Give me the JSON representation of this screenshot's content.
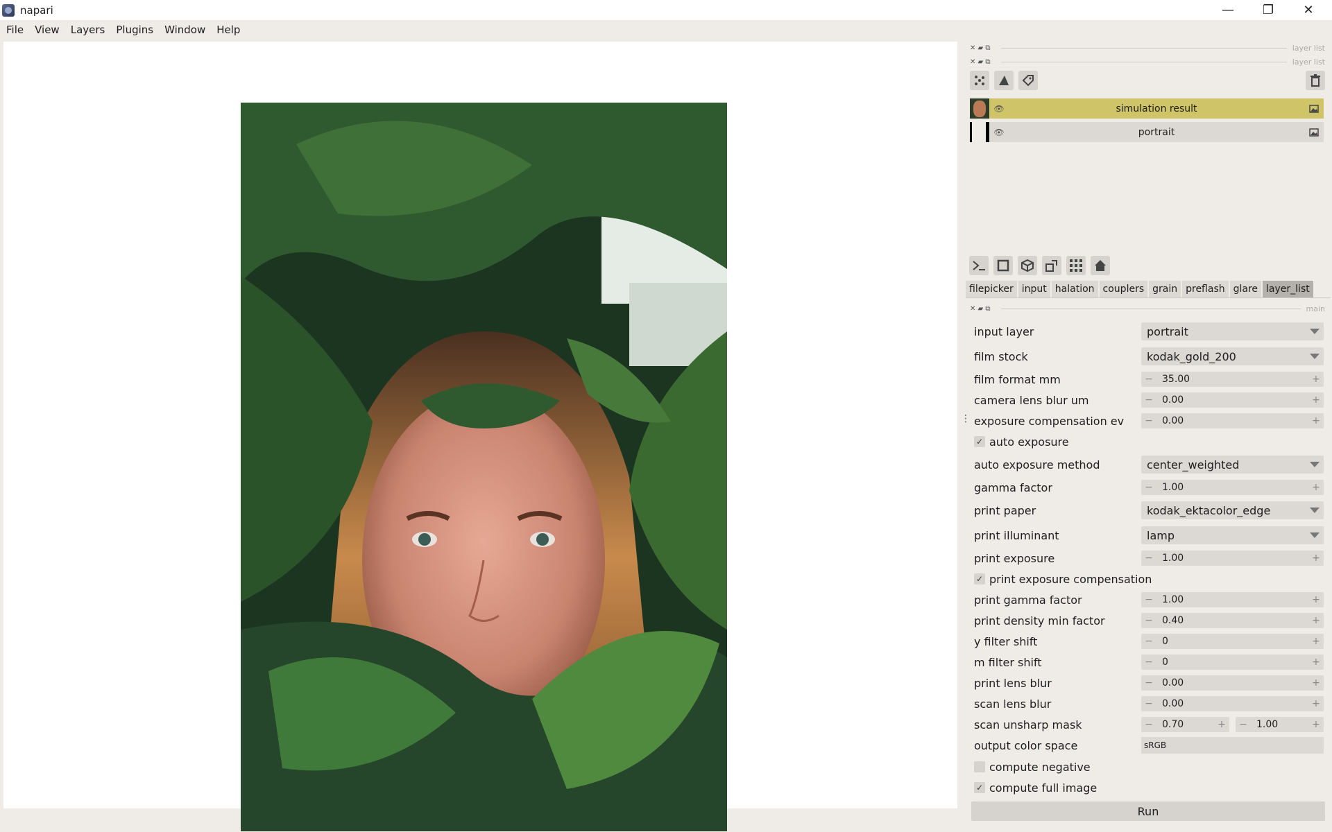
{
  "window": {
    "title": "napari",
    "minimize_icon": "—",
    "maximize_icon": "❐",
    "close_icon": "✕"
  },
  "menubar": [
    "File",
    "View",
    "Layers",
    "Plugins",
    "Window",
    "Help"
  ],
  "docks": {
    "layer_list_title_1": "layer list",
    "layer_list_title_2": "layer list",
    "main_title": "main"
  },
  "layers": [
    {
      "name": "simulation result",
      "selected": true,
      "type_icon": "image-icon"
    },
    {
      "name": "portrait",
      "selected": false,
      "type_icon": "image-icon"
    }
  ],
  "tabs": [
    "filepicker",
    "input",
    "halation",
    "couplers",
    "grain",
    "preflash",
    "glare",
    "layer_list"
  ],
  "active_tab": "layer_list",
  "form": {
    "input_layer": {
      "label": "input layer",
      "value": "portrait"
    },
    "film_stock": {
      "label": "film stock",
      "value": "kodak_gold_200"
    },
    "film_format_mm": {
      "label": "film format mm",
      "value": "35.00"
    },
    "camera_lens_blur_um": {
      "label": "camera lens blur um",
      "value": "0.00"
    },
    "exposure_compensation_ev": {
      "label": "exposure compensation ev",
      "value": "0.00"
    },
    "auto_exposure": {
      "label": "auto exposure",
      "checked": true
    },
    "auto_exposure_method": {
      "label": "auto exposure method",
      "value": "center_weighted"
    },
    "gamma_factor": {
      "label": "gamma factor",
      "value": "1.00"
    },
    "print_paper": {
      "label": "print paper",
      "value": "kodak_ektacolor_edge"
    },
    "print_illuminant": {
      "label": "print illuminant",
      "value": "lamp"
    },
    "print_exposure": {
      "label": "print exposure",
      "value": "1.00"
    },
    "print_exposure_compensation": {
      "label": "print exposure compensation",
      "checked": true
    },
    "print_gamma_factor": {
      "label": "print gamma factor",
      "value": "1.00"
    },
    "print_density_min_factor": {
      "label": "print density min factor",
      "value": "0.40"
    },
    "y_filter_shift": {
      "label": "y filter shift",
      "value": "0"
    },
    "m_filter_shift": {
      "label": "m filter shift",
      "value": "0"
    },
    "print_lens_blur": {
      "label": "print lens blur",
      "value": "0.00"
    },
    "scan_lens_blur": {
      "label": "scan lens blur",
      "value": "0.00"
    },
    "scan_unsharp_mask": {
      "label": "scan unsharp mask",
      "value1": "0.70",
      "value2": "1.00"
    },
    "output_color_space": {
      "label": "output color space",
      "value": "sRGB"
    },
    "compute_negative": {
      "label": "compute negative",
      "checked": false
    },
    "compute_full_image": {
      "label": "compute full image",
      "checked": true
    }
  },
  "run_label": "Run",
  "glyphs": {
    "minus": "−",
    "plus": "+",
    "check": "✓",
    "eye": "👁",
    "dock_ctl": "✕ ▰ ⧉"
  },
  "colors": {
    "selected_layer": "#cfc468",
    "layer_bg": "#dcd8d3",
    "panel_bg": "#efebe7"
  }
}
